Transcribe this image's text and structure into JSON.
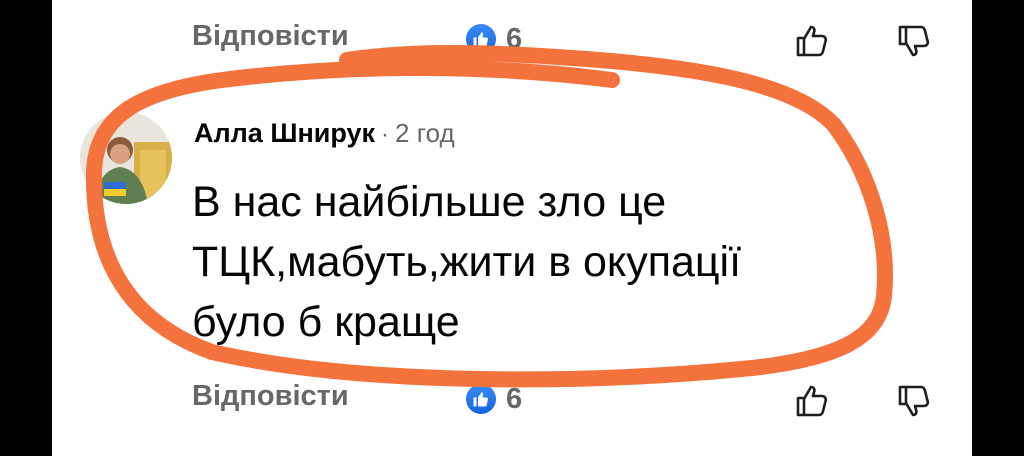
{
  "actions_top": {
    "reply_label": "Відповісти",
    "like_count": "6"
  },
  "comment": {
    "author": "Алла Шнирук",
    "separator": "·",
    "timestamp": "2 год",
    "lines": [
      "В нас найбільше зло це",
      "ТЦК,мабуть,жити в окупації",
      "було б краще"
    ]
  },
  "actions_bottom": {
    "reply_label": "Відповісти",
    "like_count": "6"
  },
  "icons": {
    "like_badge": "thumbs-up-icon",
    "upvote": "thumb-up-outline-icon",
    "downvote": "thumb-down-outline-icon"
  },
  "colors": {
    "highlight_stroke": "#f4733c",
    "like_badge": "#1877f2",
    "secondary_text": "#65676b",
    "primary_text": "#050505"
  }
}
